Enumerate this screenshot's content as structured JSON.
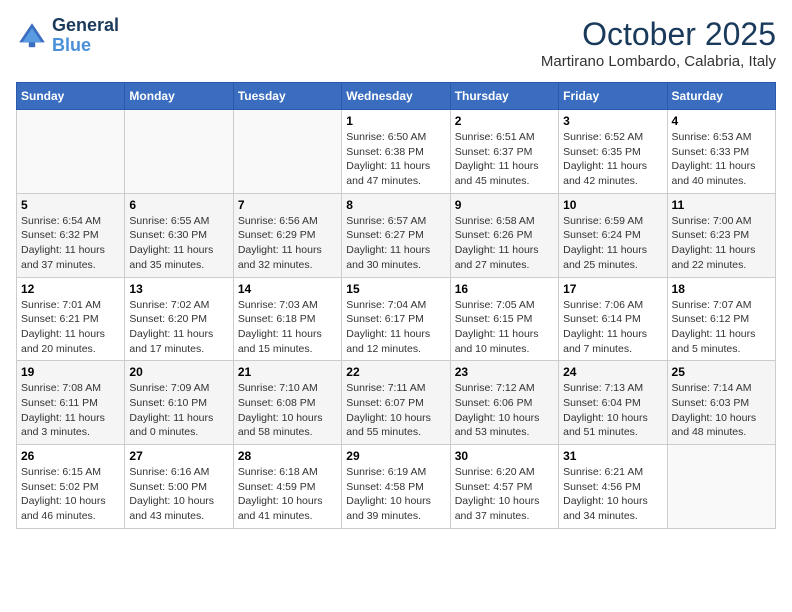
{
  "logo": {
    "line1": "General",
    "line2": "Blue"
  },
  "title": "October 2025",
  "location": "Martirano Lombardo, Calabria, Italy",
  "weekdays": [
    "Sunday",
    "Monday",
    "Tuesday",
    "Wednesday",
    "Thursday",
    "Friday",
    "Saturday"
  ],
  "weeks": [
    [
      {
        "day": "",
        "info": ""
      },
      {
        "day": "",
        "info": ""
      },
      {
        "day": "",
        "info": ""
      },
      {
        "day": "1",
        "info": "Sunrise: 6:50 AM\nSunset: 6:38 PM\nDaylight: 11 hours\nand 47 minutes."
      },
      {
        "day": "2",
        "info": "Sunrise: 6:51 AM\nSunset: 6:37 PM\nDaylight: 11 hours\nand 45 minutes."
      },
      {
        "day": "3",
        "info": "Sunrise: 6:52 AM\nSunset: 6:35 PM\nDaylight: 11 hours\nand 42 minutes."
      },
      {
        "day": "4",
        "info": "Sunrise: 6:53 AM\nSunset: 6:33 PM\nDaylight: 11 hours\nand 40 minutes."
      }
    ],
    [
      {
        "day": "5",
        "info": "Sunrise: 6:54 AM\nSunset: 6:32 PM\nDaylight: 11 hours\nand 37 minutes."
      },
      {
        "day": "6",
        "info": "Sunrise: 6:55 AM\nSunset: 6:30 PM\nDaylight: 11 hours\nand 35 minutes."
      },
      {
        "day": "7",
        "info": "Sunrise: 6:56 AM\nSunset: 6:29 PM\nDaylight: 11 hours\nand 32 minutes."
      },
      {
        "day": "8",
        "info": "Sunrise: 6:57 AM\nSunset: 6:27 PM\nDaylight: 11 hours\nand 30 minutes."
      },
      {
        "day": "9",
        "info": "Sunrise: 6:58 AM\nSunset: 6:26 PM\nDaylight: 11 hours\nand 27 minutes."
      },
      {
        "day": "10",
        "info": "Sunrise: 6:59 AM\nSunset: 6:24 PM\nDaylight: 11 hours\nand 25 minutes."
      },
      {
        "day": "11",
        "info": "Sunrise: 7:00 AM\nSunset: 6:23 PM\nDaylight: 11 hours\nand 22 minutes."
      }
    ],
    [
      {
        "day": "12",
        "info": "Sunrise: 7:01 AM\nSunset: 6:21 PM\nDaylight: 11 hours\nand 20 minutes."
      },
      {
        "day": "13",
        "info": "Sunrise: 7:02 AM\nSunset: 6:20 PM\nDaylight: 11 hours\nand 17 minutes."
      },
      {
        "day": "14",
        "info": "Sunrise: 7:03 AM\nSunset: 6:18 PM\nDaylight: 11 hours\nand 15 minutes."
      },
      {
        "day": "15",
        "info": "Sunrise: 7:04 AM\nSunset: 6:17 PM\nDaylight: 11 hours\nand 12 minutes."
      },
      {
        "day": "16",
        "info": "Sunrise: 7:05 AM\nSunset: 6:15 PM\nDaylight: 11 hours\nand 10 minutes."
      },
      {
        "day": "17",
        "info": "Sunrise: 7:06 AM\nSunset: 6:14 PM\nDaylight: 11 hours\nand 7 minutes."
      },
      {
        "day": "18",
        "info": "Sunrise: 7:07 AM\nSunset: 6:12 PM\nDaylight: 11 hours\nand 5 minutes."
      }
    ],
    [
      {
        "day": "19",
        "info": "Sunrise: 7:08 AM\nSunset: 6:11 PM\nDaylight: 11 hours\nand 3 minutes."
      },
      {
        "day": "20",
        "info": "Sunrise: 7:09 AM\nSunset: 6:10 PM\nDaylight: 11 hours\nand 0 minutes."
      },
      {
        "day": "21",
        "info": "Sunrise: 7:10 AM\nSunset: 6:08 PM\nDaylight: 10 hours\nand 58 minutes."
      },
      {
        "day": "22",
        "info": "Sunrise: 7:11 AM\nSunset: 6:07 PM\nDaylight: 10 hours\nand 55 minutes."
      },
      {
        "day": "23",
        "info": "Sunrise: 7:12 AM\nSunset: 6:06 PM\nDaylight: 10 hours\nand 53 minutes."
      },
      {
        "day": "24",
        "info": "Sunrise: 7:13 AM\nSunset: 6:04 PM\nDaylight: 10 hours\nand 51 minutes."
      },
      {
        "day": "25",
        "info": "Sunrise: 7:14 AM\nSunset: 6:03 PM\nDaylight: 10 hours\nand 48 minutes."
      }
    ],
    [
      {
        "day": "26",
        "info": "Sunrise: 6:15 AM\nSunset: 5:02 PM\nDaylight: 10 hours\nand 46 minutes."
      },
      {
        "day": "27",
        "info": "Sunrise: 6:16 AM\nSunset: 5:00 PM\nDaylight: 10 hours\nand 43 minutes."
      },
      {
        "day": "28",
        "info": "Sunrise: 6:18 AM\nSunset: 4:59 PM\nDaylight: 10 hours\nand 41 minutes."
      },
      {
        "day": "29",
        "info": "Sunrise: 6:19 AM\nSunset: 4:58 PM\nDaylight: 10 hours\nand 39 minutes."
      },
      {
        "day": "30",
        "info": "Sunrise: 6:20 AM\nSunset: 4:57 PM\nDaylight: 10 hours\nand 37 minutes."
      },
      {
        "day": "31",
        "info": "Sunrise: 6:21 AM\nSunset: 4:56 PM\nDaylight: 10 hours\nand 34 minutes."
      },
      {
        "day": "",
        "info": ""
      }
    ]
  ]
}
